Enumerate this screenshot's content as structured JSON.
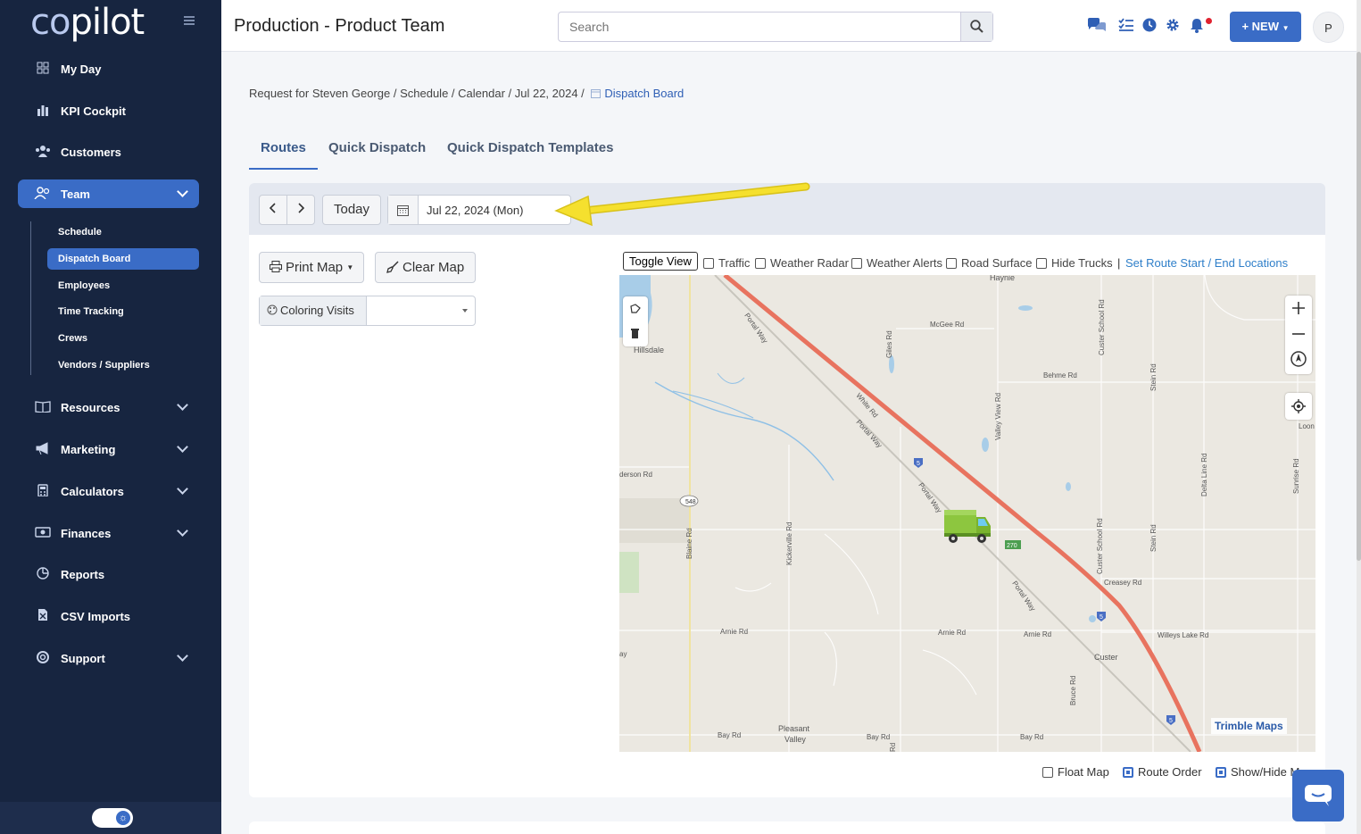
{
  "sidebar": {
    "logo": {
      "prefix": "co",
      "suffix": "pilot"
    },
    "nav": [
      {
        "label": "My Day",
        "icon": "grid-icon"
      },
      {
        "label": "KPI Cockpit",
        "icon": "bar-chart-icon"
      },
      {
        "label": "Customers",
        "icon": "users-icon"
      },
      {
        "label": "Team",
        "icon": "team-icon",
        "active": true
      },
      {
        "label": "Resources",
        "icon": "book-icon"
      },
      {
        "label": "Marketing",
        "icon": "megaphone-icon"
      },
      {
        "label": "Calculators",
        "icon": "calculator-icon"
      },
      {
        "label": "Finances",
        "icon": "money-icon"
      },
      {
        "label": "Reports",
        "icon": "pie-chart-icon"
      },
      {
        "label": "CSV Imports",
        "icon": "file-icon"
      },
      {
        "label": "Support",
        "icon": "lifebuoy-icon"
      }
    ],
    "team_sub": [
      "Schedule",
      "Dispatch Board",
      "Employees",
      "Time Tracking",
      "Crews",
      "Vendors / Suppliers"
    ]
  },
  "header": {
    "title": "Production - Product Team",
    "search_placeholder": "Search",
    "new_label": "+ NEW",
    "avatar_initial": "P"
  },
  "breadcrumb": {
    "path": "Request for Steven George / Schedule / Calendar / Jul 22, 2024 / ",
    "current": "Dispatch Board"
  },
  "tabs": [
    "Routes",
    "Quick Dispatch",
    "Quick Dispatch Templates"
  ],
  "toolbar": {
    "today_label": "Today",
    "date_value": "Jul 22, 2024 (Mon)"
  },
  "panel": {
    "print_map_label": "Print Map",
    "clear_map_label": "Clear Map",
    "coloring_label": "Coloring Visits"
  },
  "map_tools": {
    "toggle_view": "Toggle View",
    "checkboxes": [
      "Traffic",
      "Weather Radar",
      "Weather Alerts",
      "Road Surface",
      "Hide Trucks"
    ],
    "set_route_link": "Set Route Start / End Locations"
  },
  "map": {
    "labels": {
      "hillsdale": "Hillsdale",
      "haynie": "Haynie",
      "mcgee": "McGee Rd",
      "behme": "Behme Rd",
      "portal1": "Portal Way",
      "portal2": "Portal Way",
      "portal3": "Portal Way",
      "portal4": "Portal Way",
      "white": "White Rd",
      "giles": "Giles Rd",
      "valley": "Valley View Rd",
      "custer_school": "Custer School Rd",
      "stein": "Stein Rd",
      "delta": "Delta Line Rd",
      "sunrise": "Sunrise Rd",
      "loon": "Loon",
      "henderson": "derson Rd",
      "blaine": "Blaine Rd",
      "kickerville": "Kickerville Rd",
      "creasey": "Creasey Rd",
      "arnie1": "Arnie Rd",
      "arnie2": "Arnie Rd",
      "arnie3": "Arnie Rd",
      "willeys": "Willeys Lake Rd",
      "custer": "Custer",
      "bruce": "Bruce Rd",
      "bay1": "Bay Rd",
      "bay2": "Bay Rd",
      "bay3": "Bay Rd",
      "pleasant": "Pleasant",
      "valley2": "Valley",
      "ay": "ay",
      "rd": "Rd",
      "r548": "548",
      "r270": "270",
      "i5": "5",
      "trimble": "Trimble Maps"
    }
  },
  "bottom_options": [
    {
      "label": "Float Map",
      "checked": false
    },
    {
      "label": "Route Order",
      "checked": true
    },
    {
      "label": "Show/Hide M",
      "checked": true
    }
  ],
  "colors": {
    "sidebar": "#172540",
    "accent": "#3a6cc6",
    "highway": "#e8735f",
    "annotation_arrow": "#f5e02e"
  }
}
